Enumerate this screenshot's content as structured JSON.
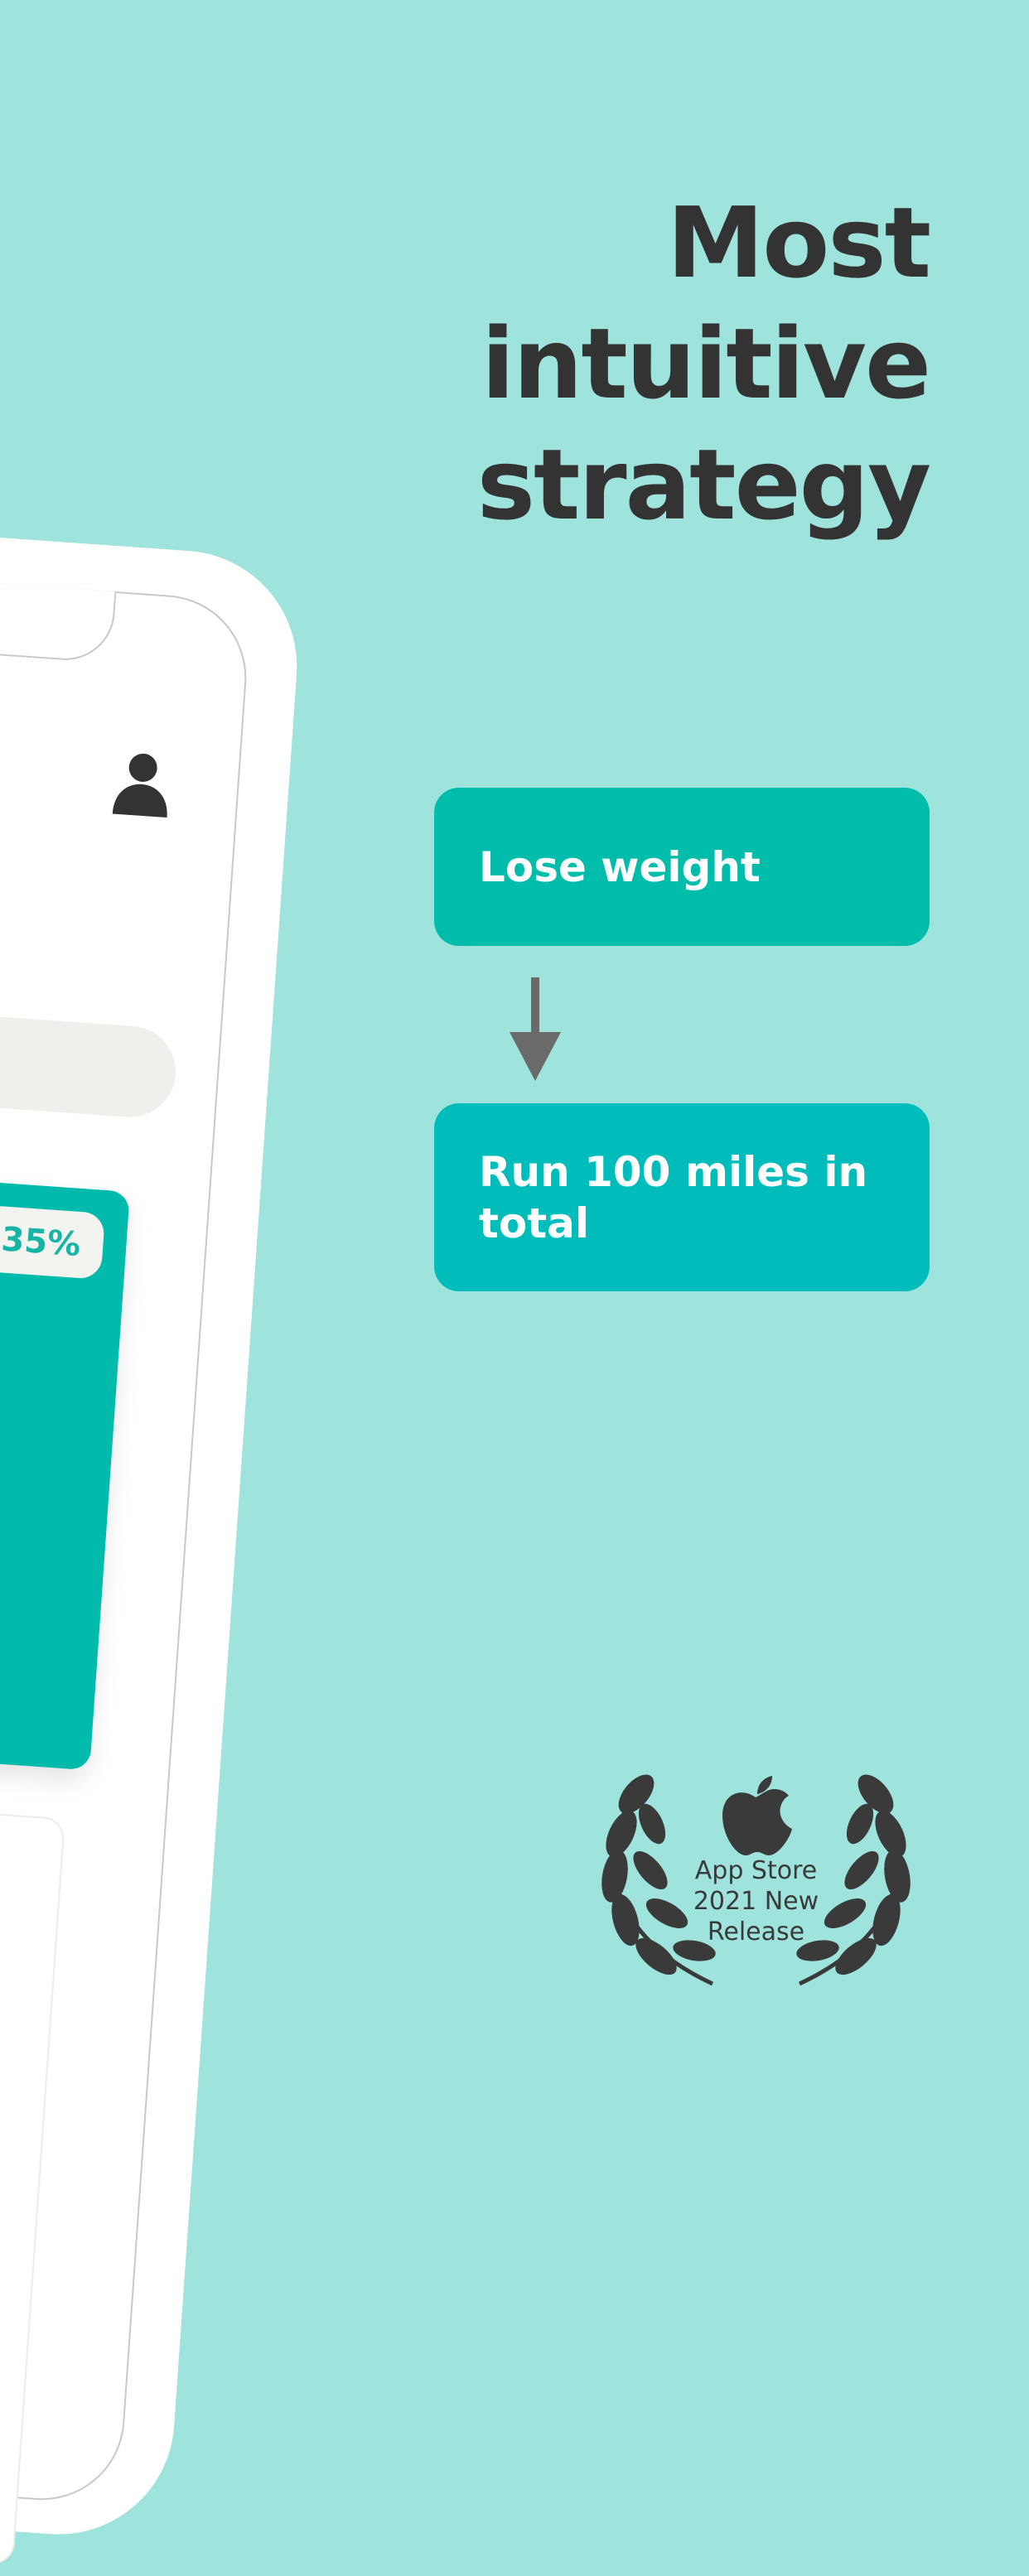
{
  "headline": {
    "line1": "Most",
    "line2": "intuitive",
    "line3": "strategy"
  },
  "phone": {
    "progress_percent": "35%",
    "progress_value": 35
  },
  "goals": {
    "primary": "Lose weight",
    "secondary": "Run 100 miles in total"
  },
  "award": {
    "line1": "App Store",
    "line2": "2021 New",
    "line3": "Release",
    "icon": "apple-logo-icon"
  },
  "colors": {
    "background": "#9fe3dd",
    "primary_teal": "#00bcab",
    "secondary_teal": "#00bdbc",
    "text_dark": "#333333"
  }
}
